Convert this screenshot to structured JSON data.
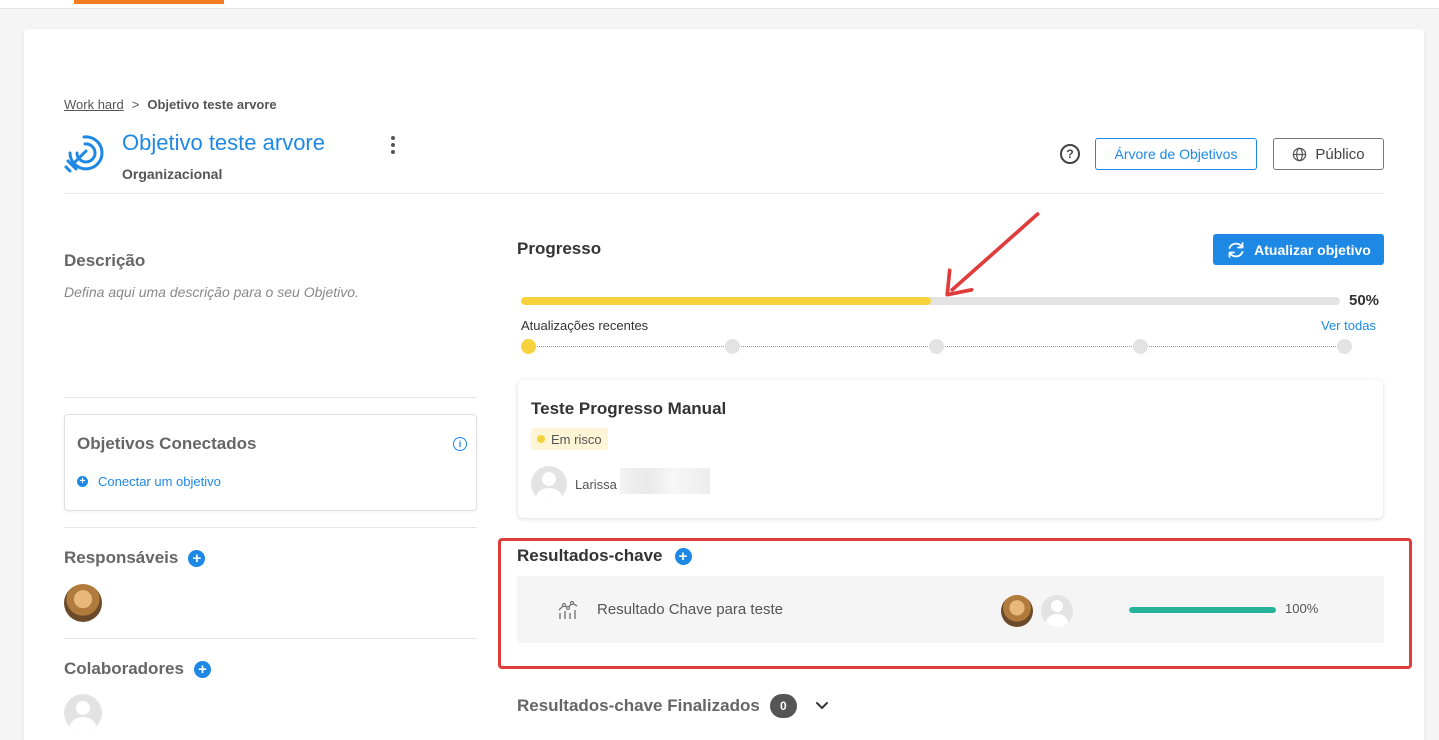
{
  "breadcrumb": {
    "parent": "Work hard",
    "separator": ">",
    "current": "Objetivo teste arvore"
  },
  "objective": {
    "title": "Objetivo teste arvore",
    "type": "Organizacional",
    "icon": "target-rocket-icon"
  },
  "header": {
    "help_symbol": "?",
    "tree_button": "Árvore de Objetivos",
    "visibility_button": "Público"
  },
  "description": {
    "title": "Descrição",
    "placeholder": "Defina aqui uma descrição para o seu Objetivo."
  },
  "connected": {
    "title": "Objetivos Conectados",
    "info_symbol": "i",
    "link": "Conectar um objetivo"
  },
  "responsibles": {
    "title": "Responsáveis"
  },
  "collaborators": {
    "title": "Colaboradores"
  },
  "progress": {
    "title": "Progresso",
    "update_button": "Atualizar objetivo",
    "value": 50,
    "value_label": "50%",
    "recent_label": "Atualizações recentes",
    "see_all": "Ver todas",
    "timeline_points": 5,
    "timeline_active": 1
  },
  "update_card": {
    "title": "Teste Progresso Manual",
    "status": "Em risco",
    "person": "Larissa"
  },
  "key_results": {
    "title": "Resultados-chave",
    "items": [
      {
        "name": "Resultado Chave para teste",
        "progress": 100,
        "progress_label": "100%"
      }
    ]
  },
  "finished": {
    "title": "Resultados-chave Finalizados",
    "count": "0"
  },
  "colors": {
    "brand_blue": "#1e88e5",
    "progress_yellow": "#f6d33c",
    "kr_green": "#26b39a",
    "highlight_red": "#e03c3c",
    "topbar_orange": "#f47b20"
  }
}
